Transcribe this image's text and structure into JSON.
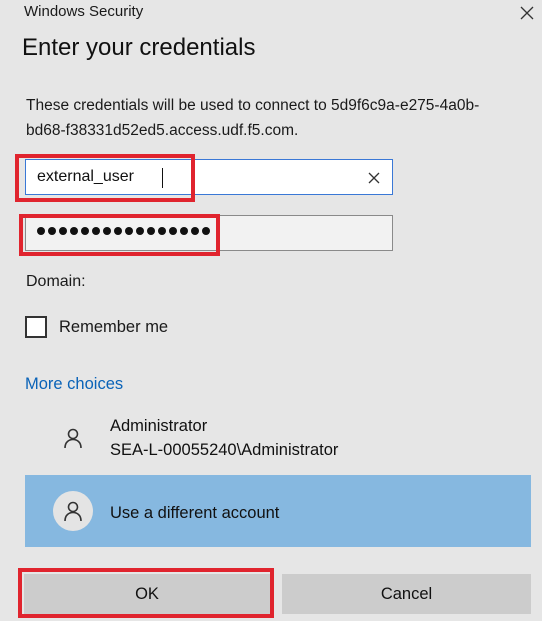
{
  "window": {
    "title": "Windows Security",
    "close_icon": "close-icon"
  },
  "dialog": {
    "heading": "Enter your credentials",
    "description": "These credentials will be used to connect to 5d9f6c9a-e275-4a0b-bd68-f38331d52ed5.access.udf.f5.com."
  },
  "form": {
    "username_value": "external_user",
    "password_length": 16,
    "domain_label": "Domain:",
    "remember_label": "Remember me",
    "remember_checked": false
  },
  "more_choices": {
    "label": "More choices",
    "accounts": [
      {
        "name": "Administrator",
        "detail": "SEA-L-00055240\\Administrator",
        "selected": false
      },
      {
        "name": "Use a different account",
        "selected": true
      }
    ]
  },
  "buttons": {
    "ok_label": "OK",
    "cancel_label": "Cancel"
  },
  "colors": {
    "background": "#e6e6e6",
    "link": "#0a63b8",
    "selected_account": "#86b8e0",
    "highlight": "#e0242e",
    "button": "#cccccc"
  }
}
